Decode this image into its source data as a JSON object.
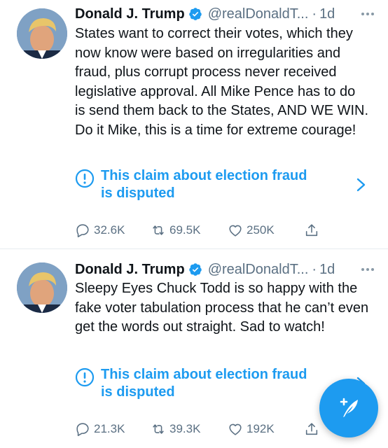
{
  "colors": {
    "accent": "#1d9bf0",
    "text": "#0f1419",
    "secondary": "#5b7083",
    "divider": "#e6ecf0"
  },
  "tweets": [
    {
      "author_name": "Donald J. Trump",
      "verified_icon": "verified-badge-icon",
      "handle": "@realDonaldT...",
      "separator": "·",
      "time": "1d",
      "text": "States want to correct their votes, which they now know were based on irregularities and fraud, plus corrupt process never received legislative approval.  All Mike Pence has to do is send them back to the States, AND WE WIN. Do it Mike, this is a time for extreme courage!",
      "claim_label": "This claim about election fraud\nis disputed",
      "replies": "32.6K",
      "retweets": "69.5K",
      "likes": "250K"
    },
    {
      "author_name": "Donald J. Trump",
      "verified_icon": "verified-badge-icon",
      "handle": "@realDonaldT...",
      "separator": "·",
      "time": "1d",
      "text": "Sleepy Eyes Chuck Todd is so happy with the fake voter tabulation process that he can’t even get the words out straight. Sad to watch!",
      "claim_label": "This claim about election fraud\nis disputed",
      "replies": "21.3K",
      "retweets": "39.3K",
      "likes": "192K"
    }
  ],
  "icons": {
    "reply": "reply-icon",
    "retweet": "retweet-icon",
    "like": "heart-icon",
    "share": "share-icon",
    "more": "more-icon",
    "claim": "exclamation-circle-icon",
    "chevron": "chevron-right-icon",
    "compose": "compose-tweet-icon"
  }
}
